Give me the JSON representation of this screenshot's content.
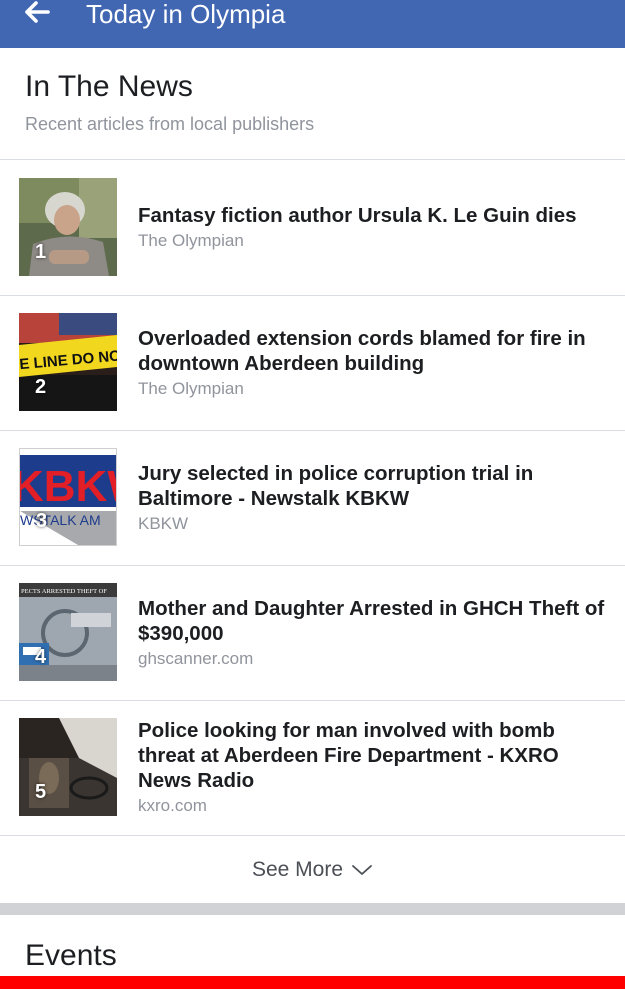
{
  "header": {
    "title": "Today in Olympia",
    "back_icon": "back-arrow-icon",
    "background_color": "#4267b2"
  },
  "news": {
    "title": "In The News",
    "subtitle": "Recent articles from local publishers",
    "articles": [
      {
        "rank": "1",
        "headline": "Fantasy fiction author Ursula K. Le Guin dies",
        "source": "The Olympian",
        "thumb_text": ""
      },
      {
        "rank": "2",
        "headline": "Overloaded extension cords blamed for fire in downtown Aberdeen building",
        "source": "The Olympian",
        "thumb_text": "E LINE DO NOT CR"
      },
      {
        "rank": "3",
        "headline": "Jury selected in police corruption trial in Baltimore - Newstalk KBKW",
        "source": "KBKW",
        "thumb_text": "KBKW",
        "thumb_subtext": "WSTALK AM"
      },
      {
        "rank": "4",
        "headline": "Mother and Daughter Arrested in GHCH Theft of $390,000",
        "source": "ghscanner.com",
        "thumb_text": "PECTS ARRESTED THEFT OF"
      },
      {
        "rank": "5",
        "headline": "Police looking for man involved with bomb threat at Aberdeen Fire Department - KXRO News Radio",
        "source": "kxro.com",
        "thumb_text": ""
      }
    ],
    "see_more_label": "See More",
    "see_more_icon": "chevron-down-icon"
  },
  "events": {
    "title": "Events"
  },
  "colors": {
    "accent_red": "#ff0000",
    "divider": "#d1d2d6"
  }
}
